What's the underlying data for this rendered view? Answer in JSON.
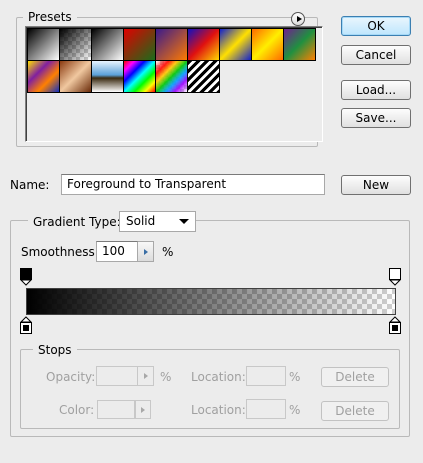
{
  "presets": {
    "title": "Presets",
    "swatches": [
      {
        "name": "foreground-to-background",
        "css": "linear-gradient(135deg,#000 0%,#fff 100%)"
      },
      {
        "name": "foreground-to-transparent",
        "css": "checker-black"
      },
      {
        "name": "black-white",
        "css": "linear-gradient(135deg,#000 0%,#fff 100%)"
      },
      {
        "name": "red-green",
        "css": "linear-gradient(135deg,#e00000 0%,#1a6d1a 100%)"
      },
      {
        "name": "violet-orange",
        "css": "linear-gradient(135deg,#3a1a8c 0%,#ff7a00 100%)"
      },
      {
        "name": "blue-red-yellow",
        "css": "linear-gradient(135deg,#1010c0 0%,#e01010 50%,#ffd800 100%)"
      },
      {
        "name": "blue-yellow-blue",
        "css": "linear-gradient(135deg,#1020d0 0%,#ffe000 50%,#1020d0 100%)"
      },
      {
        "name": "orange-yellow-orange",
        "css": "linear-gradient(135deg,#ff6a00 0%,#ffee00 50%,#ff6a00 100%)"
      },
      {
        "name": "violet-green-orange",
        "css": "linear-gradient(135deg,#702090 0%,#209040 50%,#ff8000 100%)"
      },
      {
        "name": "yellow-violet-orange-blue",
        "css": "linear-gradient(135deg,#ffe000 0%,#8020a0 35%,#ff8000 65%,#1030c0 100%)"
      },
      {
        "name": "copper",
        "css": "linear-gradient(135deg,#8a3a10 0%,#f0c8a0 50%,#6a2a08 100%)"
      },
      {
        "name": "chrome",
        "css": "linear-gradient(180deg,#e8f4ff 0%,#5aa0d8 45%,#3a2a10 55%,#fff 100%)"
      },
      {
        "name": "spectrum",
        "css": "linear-gradient(135deg,#ff0000,#ff00ff,#0000ff,#00ffff,#00ff00,#ffff00,#ff0000)"
      },
      {
        "name": "transparent-rainbow",
        "css": "checker-rainbow"
      },
      {
        "name": "transparent-stripes",
        "css": "repeating-linear-gradient(135deg,#000 0px,#000 3px,#fff 3px,#fff 6px)"
      }
    ]
  },
  "buttons": {
    "ok": "OK",
    "cancel": "Cancel",
    "load": "Load...",
    "save": "Save...",
    "new": "New"
  },
  "name_field": {
    "label": "Name:",
    "value": "Foreground to Transparent"
  },
  "gradient": {
    "type_label": "Gradient Type:",
    "type_value": "Solid",
    "smoothness_label": "Smoothness:",
    "smoothness_value": "100",
    "smoothness_unit": "%",
    "colors": {
      "start": "#000000",
      "end": "#000000"
    },
    "start_opacity_percent": 100,
    "end_opacity_percent": 0
  },
  "stops": {
    "title": "Stops",
    "opacity_label": "Opacity:",
    "opacity_unit": "%",
    "location_label_1": "Location:",
    "location_unit_1": "%",
    "delete_1": "Delete",
    "color_label": "Color:",
    "location_label_2": "Location:",
    "location_unit_2": "%",
    "delete_2": "Delete"
  }
}
